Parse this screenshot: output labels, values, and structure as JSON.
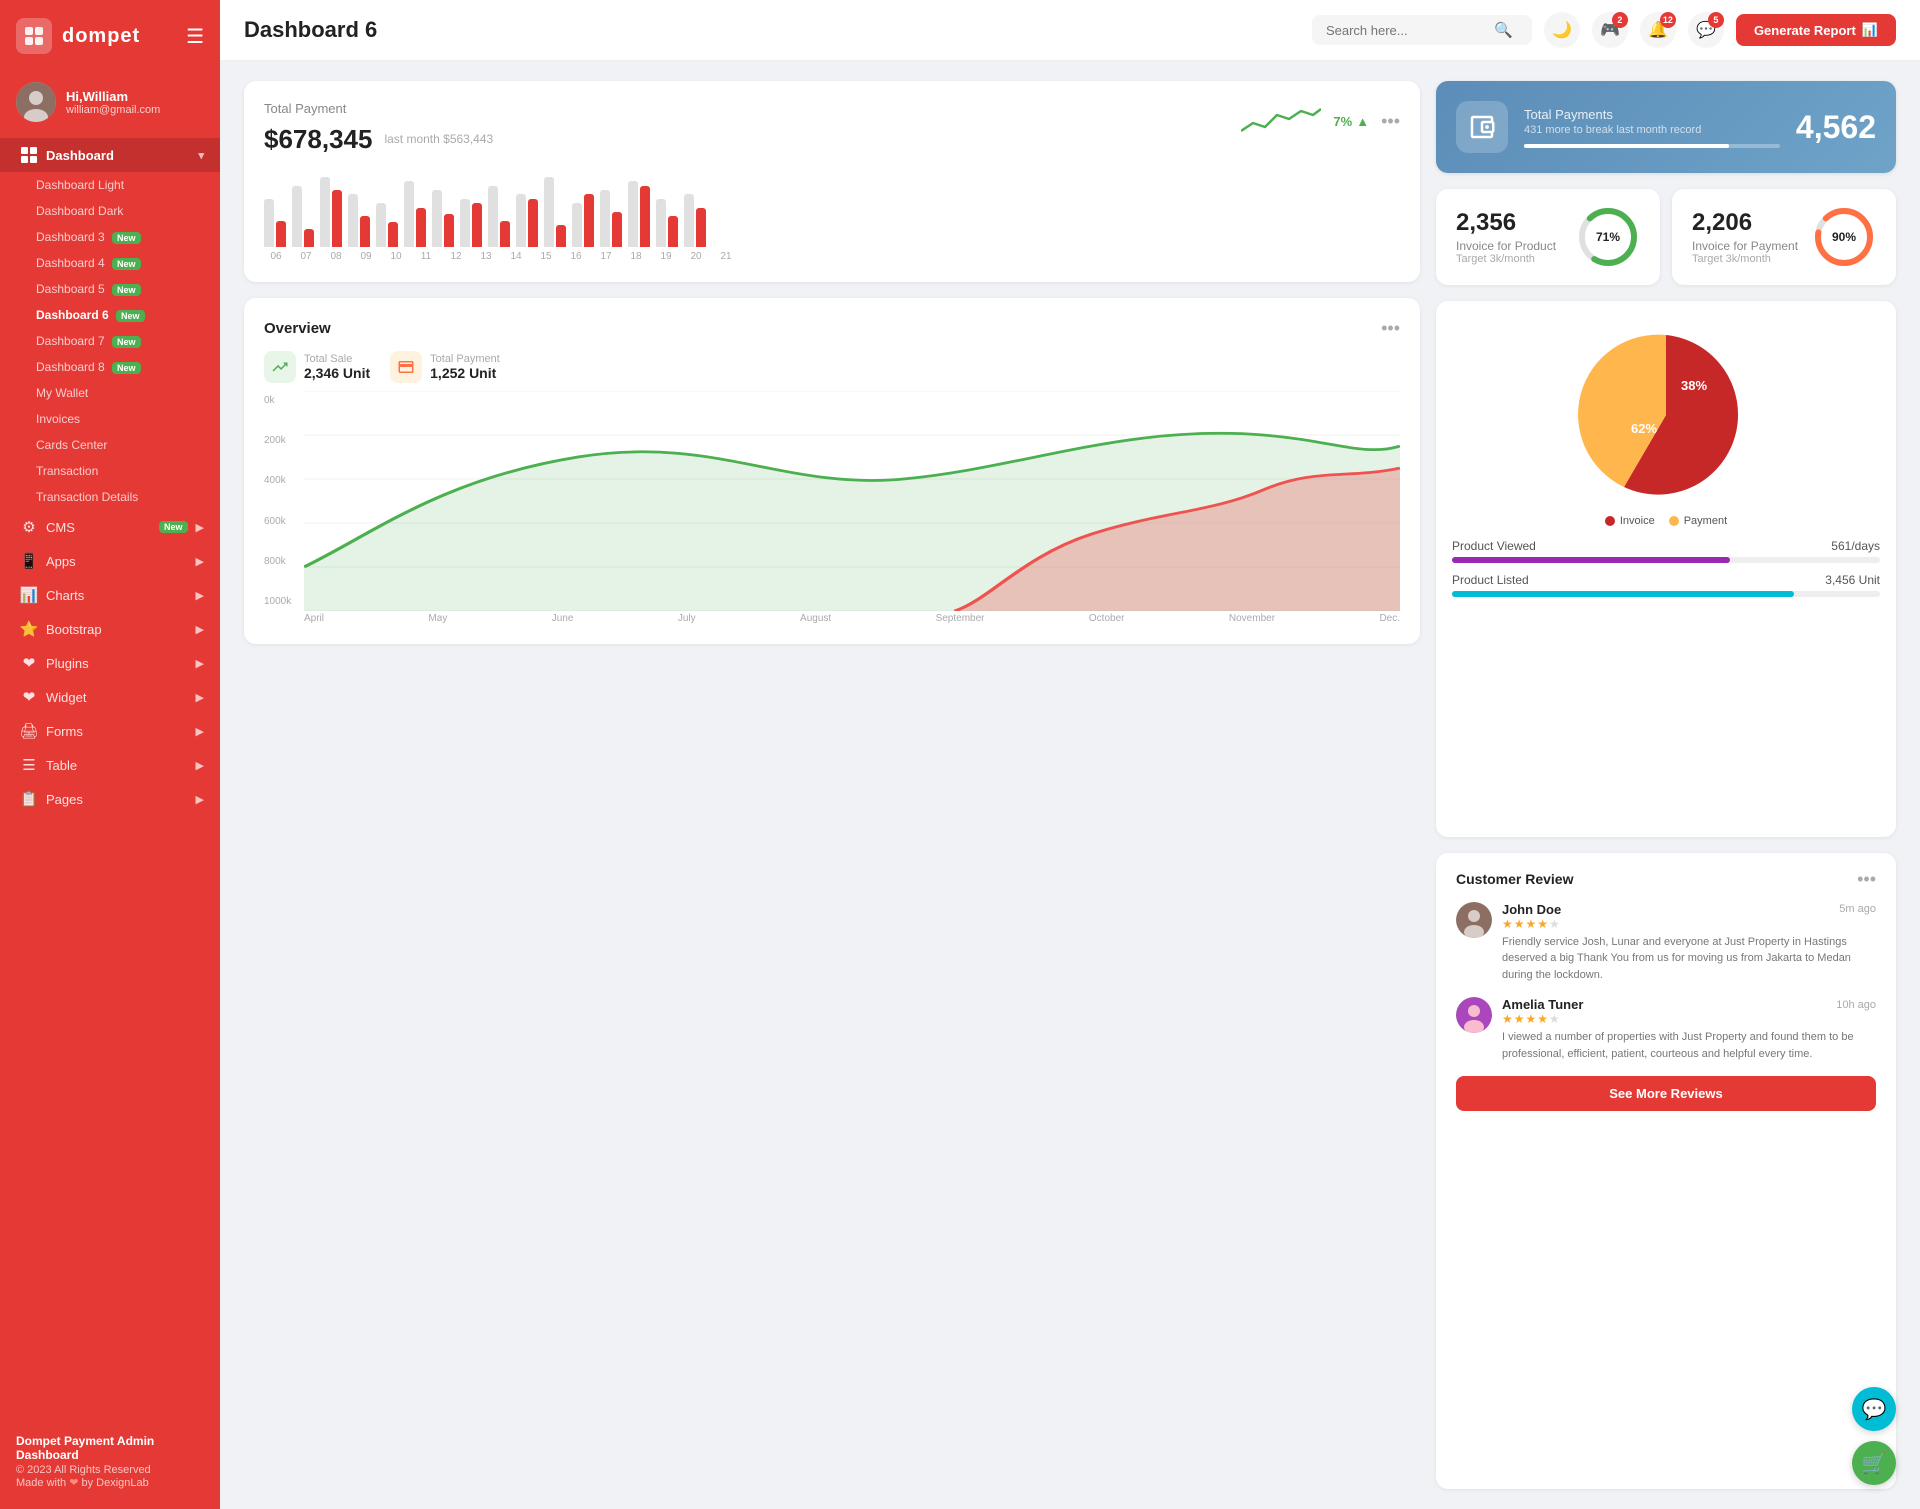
{
  "sidebar": {
    "brand": "dompet",
    "hamburger": "☰",
    "user": {
      "name": "Hi,William",
      "email": "william@gmail.com"
    },
    "dashboard_label": "Dashboard",
    "sub_items": [
      {
        "label": "Dashboard Light",
        "new": false,
        "active": false
      },
      {
        "label": "Dashboard Dark",
        "new": false,
        "active": false
      },
      {
        "label": "Dashboard 3",
        "new": true,
        "active": false
      },
      {
        "label": "Dashboard 4",
        "new": true,
        "active": false
      },
      {
        "label": "Dashboard 5",
        "new": true,
        "active": false
      },
      {
        "label": "Dashboard 6",
        "new": true,
        "active": true
      },
      {
        "label": "Dashboard 7",
        "new": true,
        "active": false
      },
      {
        "label": "Dashboard 8",
        "new": true,
        "active": false
      },
      {
        "label": "My Wallet",
        "new": false,
        "active": false
      },
      {
        "label": "Invoices",
        "new": false,
        "active": false
      },
      {
        "label": "Cards Center",
        "new": false,
        "active": false
      },
      {
        "label": "Transaction",
        "new": false,
        "active": false
      },
      {
        "label": "Transaction Details",
        "new": false,
        "active": false
      }
    ],
    "main_items": [
      {
        "label": "CMS",
        "new": true,
        "icon": "⚙"
      },
      {
        "label": "Apps",
        "new": false,
        "icon": "📱"
      },
      {
        "label": "Charts",
        "new": false,
        "icon": "📊"
      },
      {
        "label": "Bootstrap",
        "new": false,
        "icon": "⭐"
      },
      {
        "label": "Plugins",
        "new": false,
        "icon": "❤"
      },
      {
        "label": "Widget",
        "new": false,
        "icon": "❤"
      },
      {
        "label": "Forms",
        "new": false,
        "icon": "🖨"
      },
      {
        "label": "Table",
        "new": false,
        "icon": "☰"
      },
      {
        "label": "Pages",
        "new": false,
        "icon": "📋"
      }
    ],
    "footer": {
      "title": "Dompet Payment Admin Dashboard",
      "copy": "© 2023 All Rights Reserved",
      "made_by": "Made with ❤ by DexignLab"
    }
  },
  "topbar": {
    "title": "Dashboard 6",
    "search_placeholder": "Search here...",
    "notifications": [
      {
        "icon": "🎮",
        "badge": 2
      },
      {
        "icon": "🔔",
        "badge": 12
      },
      {
        "icon": "💬",
        "badge": 5
      }
    ],
    "generate_btn": "Generate Report"
  },
  "total_payment": {
    "title": "Total Payment",
    "amount": "$678,345",
    "last_month": "last month $563,443",
    "trend": "7%",
    "trend_up": true,
    "bars": [
      {
        "grey": 55,
        "red": 30
      },
      {
        "grey": 70,
        "red": 20
      },
      {
        "grey": 80,
        "red": 65
      },
      {
        "grey": 60,
        "red": 35
      },
      {
        "grey": 50,
        "red": 28
      },
      {
        "grey": 75,
        "red": 45
      },
      {
        "grey": 65,
        "red": 38
      },
      {
        "grey": 55,
        "red": 50
      },
      {
        "grey": 70,
        "red": 30
      },
      {
        "grey": 60,
        "red": 55
      },
      {
        "grey": 80,
        "red": 25
      },
      {
        "grey": 50,
        "red": 60
      },
      {
        "grey": 65,
        "red": 40
      },
      {
        "grey": 75,
        "red": 70
      },
      {
        "grey": 55,
        "red": 35
      },
      {
        "grey": 60,
        "red": 45
      }
    ],
    "bar_labels": [
      "06",
      "07",
      "08",
      "09",
      "10",
      "11",
      "12",
      "13",
      "14",
      "15",
      "16",
      "17",
      "18",
      "19",
      "20",
      "21"
    ]
  },
  "overview": {
    "title": "Overview",
    "total_sale_label": "Total Sale",
    "total_sale_value": "2,346 Unit",
    "total_payment_label": "Total Payment",
    "total_payment_value": "1,252 Unit",
    "y_labels": [
      "1000k",
      "800k",
      "600k",
      "400k",
      "200k",
      "0k"
    ],
    "x_labels": [
      "April",
      "May",
      "June",
      "July",
      "August",
      "September",
      "October",
      "November",
      "Dec."
    ]
  },
  "total_payments_card": {
    "label": "Total Payments",
    "sub": "431 more to break last month record",
    "value": "4,562",
    "progress_pct": 80
  },
  "invoice_product": {
    "value": "2,356",
    "label": "Invoice for Product",
    "target": "Target 3k/month",
    "pct": 71,
    "color": "#4caf50"
  },
  "invoice_payment": {
    "value": "2,206",
    "label": "Invoice for Payment",
    "target": "Target 3k/month",
    "pct": 90,
    "color": "#ff7043"
  },
  "pie_chart": {
    "invoice_pct": 62,
    "payment_pct": 38,
    "invoice_label": "Invoice",
    "payment_label": "Payment",
    "invoice_color": "#c62828",
    "payment_color": "#ffb74d"
  },
  "product_stats": [
    {
      "label": "Product Viewed",
      "value": "561/days",
      "pct": 65,
      "color": "#9c27b0"
    },
    {
      "label": "Product Listed",
      "value": "3,456 Unit",
      "pct": 80,
      "color": "#00bcd4"
    }
  ],
  "customer_review": {
    "title": "Customer Review",
    "reviews": [
      {
        "name": "John Doe",
        "time": "5m ago",
        "stars": 4,
        "text": "Friendly service Josh, Lunar and everyone at Just Property in Hastings deserved a big Thank You from us for moving us from Jakarta to Medan during the lockdown."
      },
      {
        "name": "Amelia Tuner",
        "time": "10h ago",
        "stars": 4,
        "text": "I viewed a number of properties with Just Property and found them to be professional, efficient, patient, courteous and helpful every time."
      }
    ],
    "see_more_btn": "See More Reviews"
  },
  "floating_btns": [
    {
      "color": "#00bcd4",
      "icon": "💬"
    },
    {
      "color": "#4caf50",
      "icon": "🛒"
    }
  ]
}
